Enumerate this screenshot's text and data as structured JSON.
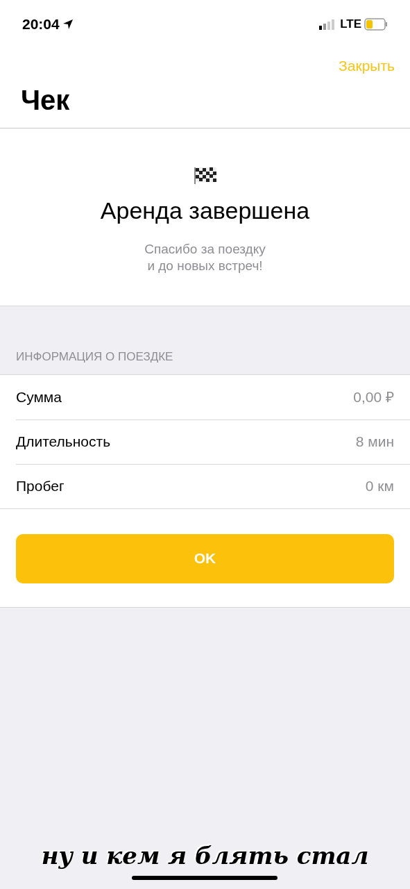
{
  "status_bar": {
    "time": "20:04",
    "network": "LTE"
  },
  "nav": {
    "close": "Закрыть",
    "title": "Чек"
  },
  "summary": {
    "heading": "Аренда завершена",
    "message": "Спасибо за поездку\nи до новых встреч!"
  },
  "trip_info": {
    "header": "ИНФОРМАЦИЯ О ПОЕЗДКЕ",
    "rows": [
      {
        "label": "Сумма",
        "value": "0,00 ₽"
      },
      {
        "label": "Длительность",
        "value": "8 мин"
      },
      {
        "label": "Пробег",
        "value": "0 км"
      }
    ]
  },
  "ok_button": "OK",
  "caption": "ну и кем я блять стал"
}
